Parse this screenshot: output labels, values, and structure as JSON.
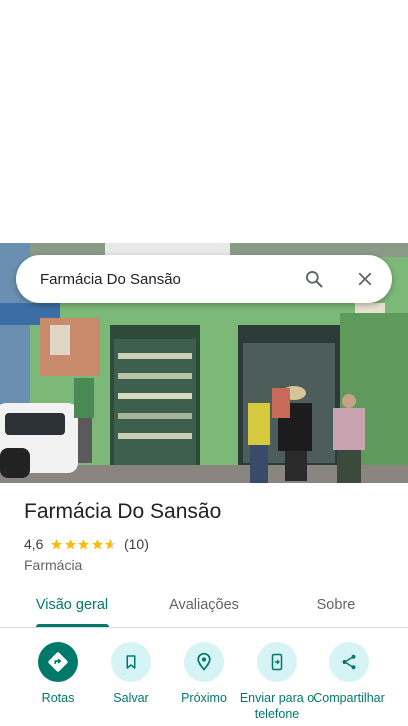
{
  "search": {
    "query": "Farmácia Do Sansão"
  },
  "place": {
    "name": "Farmácia Do Sansão",
    "rating": "4,6",
    "stars": 4.6,
    "review_count": "(10)",
    "category": "Farmácia"
  },
  "tabs": [
    {
      "label": "Visão geral",
      "selected": true
    },
    {
      "label": "Avaliações",
      "selected": false
    },
    {
      "label": "Sobre",
      "selected": false
    }
  ],
  "actions": [
    {
      "label": "Rotas",
      "icon": "directions-icon"
    },
    {
      "label": "Salvar",
      "icon": "bookmark-icon"
    },
    {
      "label": "Próximo",
      "icon": "nearby-icon"
    },
    {
      "label": "Enviar para o telefone",
      "icon": "send-to-phone-icon"
    },
    {
      "label": "Compartilhar",
      "icon": "share-icon"
    }
  ],
  "colors": {
    "accent": "#00796b",
    "action_bg": "#d6f4f6",
    "star": "#fbbc04"
  }
}
